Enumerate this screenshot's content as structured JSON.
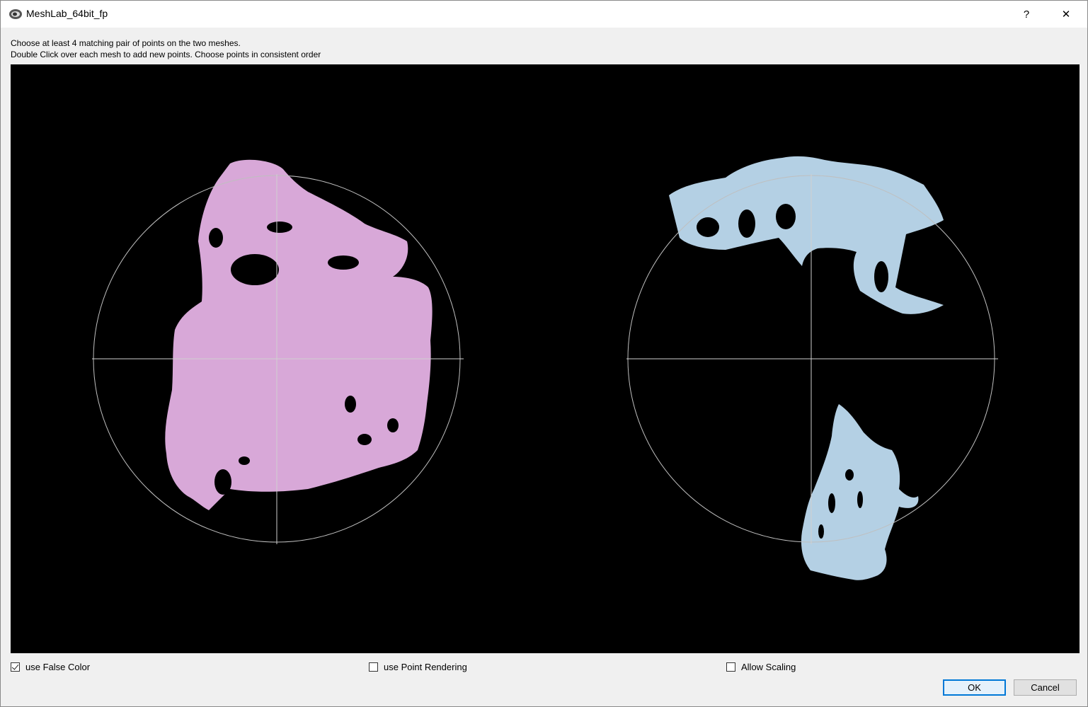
{
  "window": {
    "title": "MeshLab_64bit_fp",
    "help_label": "?",
    "close_label": "✕"
  },
  "instructions": {
    "line1": "Choose at least 4 matching pair of points on the two meshes.",
    "line2": "Double Click over each mesh to add new points. Choose points in consistent order"
  },
  "viewports": {
    "left_mesh_color": "#d8a8d8",
    "right_mesh_color": "#b4d0e4"
  },
  "options": {
    "false_color": {
      "label": "use False Color",
      "checked": true
    },
    "point_rendering": {
      "label": "use Point Rendering",
      "checked": false
    },
    "allow_scaling": {
      "label": "Allow Scaling",
      "checked": false
    }
  },
  "buttons": {
    "ok": "OK",
    "cancel": "Cancel"
  },
  "icons": [
    "meshlab-app-icon",
    "help-icon",
    "close-icon",
    "checkbox-icon"
  ]
}
